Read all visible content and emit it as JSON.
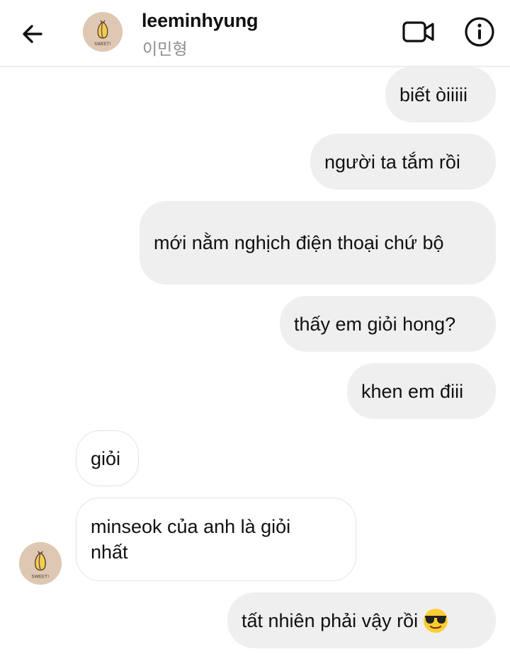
{
  "header": {
    "username": "leeminhyung",
    "display_name": "이민형",
    "avatar_text": "SWEET!"
  },
  "messages": [
    {
      "sender": "me",
      "text": "biết òiiiii"
    },
    {
      "sender": "me",
      "text": "người ta tắm rồi"
    },
    {
      "sender": "me",
      "text": "mới nằm nghịch điện thoại chứ bộ"
    },
    {
      "sender": "me",
      "text": "thấy em giỏi hong?"
    },
    {
      "sender": "me",
      "text": "khen em điii"
    },
    {
      "sender": "them",
      "text": "giỏi"
    },
    {
      "sender": "them",
      "text": "minseok của anh là giỏi nhất"
    },
    {
      "sender": "me",
      "text": "tất nhiên phải vậy rồi",
      "emoji": "sunglasses-emoji"
    }
  ],
  "colors": {
    "my_bubble": "#efefef",
    "their_bubble_border": "#e3e3e3",
    "subtitle": "#8e8e8e",
    "avatar_bg": "#dfc8b3"
  }
}
